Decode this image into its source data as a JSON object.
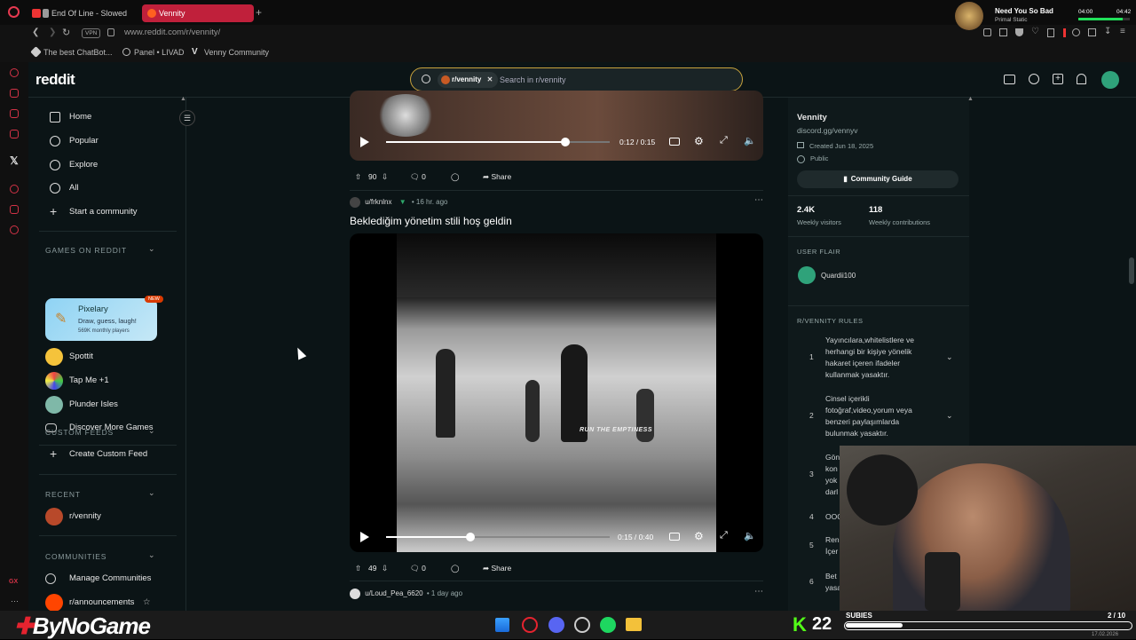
{
  "browser": {
    "tabs": [
      {
        "label": "End Of Line - Slowed"
      },
      {
        "label": "Vennity"
      }
    ],
    "url": "www.reddit.com/r/vennity/",
    "vpn_label": "VPN",
    "bookmarks": [
      {
        "label": "The best ChatBot..."
      },
      {
        "label": "Panel • LIVAD"
      },
      {
        "label": "Venny Community"
      }
    ],
    "media": {
      "title": "Need You So Bad",
      "artist": "Primal Static",
      "time_left": "04:00",
      "time_right": "04:42"
    }
  },
  "reddit": {
    "logo": "reddit",
    "search": {
      "chip": "r/vennity",
      "placeholder": "Search in r/vennity"
    },
    "nav": [
      {
        "label": "Home",
        "icon": "home-icon"
      },
      {
        "label": "Popular",
        "icon": "popular-icon"
      },
      {
        "label": "Explore",
        "icon": "explore-icon"
      },
      {
        "label": "All",
        "icon": "all-icon"
      },
      {
        "label": "Start a community",
        "icon": "plus-icon"
      }
    ],
    "games_header": "GAMES ON REDDIT",
    "featured_game": {
      "name": "Pixelary",
      "tagline": "Draw, guess, laugh!",
      "players": "569K monthly players",
      "badge": "NEW"
    },
    "games": [
      {
        "label": "Spottit"
      },
      {
        "label": "Tap Me +1"
      },
      {
        "label": "Plunder Isles"
      },
      {
        "label": "Discover More Games"
      }
    ],
    "custom_feeds_header": "CUSTOM FEEDS",
    "create_custom_feed": "Create Custom Feed",
    "recent_header": "RECENT",
    "recent": [
      {
        "label": "r/vennity"
      }
    ],
    "communities_header": "COMMUNITIES",
    "manage_communities": "Manage Communities",
    "announcements": "r/announcements"
  },
  "feed": {
    "post1": {
      "time": "0:12 / 0:15",
      "progress": 0.8,
      "upvotes": "90",
      "comments": "0",
      "share": "Share"
    },
    "post2": {
      "author": "u/frknlnx",
      "age": "16 hr. ago",
      "title": "Beklediğim yönetim stili hoş geldin",
      "video_overlay_text": "RUN THE EMPTINESS",
      "time": "0:15 / 0:40",
      "progress": 0.375,
      "upvotes": "49",
      "comments": "0",
      "share": "Share"
    },
    "post3": {
      "author": "u/Loud_Pea_6620",
      "age": "1 day ago"
    }
  },
  "sidebar": {
    "community": "Vennity",
    "link": "discord.gg/vennyv",
    "created": "Created Jun 18, 2025",
    "visibility": "Public",
    "guide_button": "Community Guide",
    "weekly_visitors": "2.4K",
    "weekly_visitors_label": "Weekly visitors",
    "weekly_contrib": "118",
    "weekly_contrib_label": "Weekly contributions",
    "user_flair_header": "USER FLAIR",
    "flair_name": "Quardii100",
    "rules_header": "R/VENNITY RULES",
    "rules": [
      {
        "n": "1",
        "text": "Yayıncılara,whitelistlere ve herhangi bir kişiye yönelik hakaret içeren ifadeler kullanmak yasaktır."
      },
      {
        "n": "2",
        "text": "Cinsel içerikli fotoğraf,video,yorum veya benzeri paylaşımlarda bulunmak yasaktır."
      },
      {
        "n": "3",
        "text": "Gön kon yok darl"
      },
      {
        "n": "4",
        "text": "OOC"
      },
      {
        "n": "5",
        "text": "Ren İçer"
      },
      {
        "n": "6",
        "text": "Bet yasa"
      }
    ]
  },
  "overlay": {
    "brand": "ByNoGame",
    "kick_count": "22",
    "subs_label": "SUBIES",
    "subs_count": "2 / 10",
    "date": "17.02.2026"
  }
}
